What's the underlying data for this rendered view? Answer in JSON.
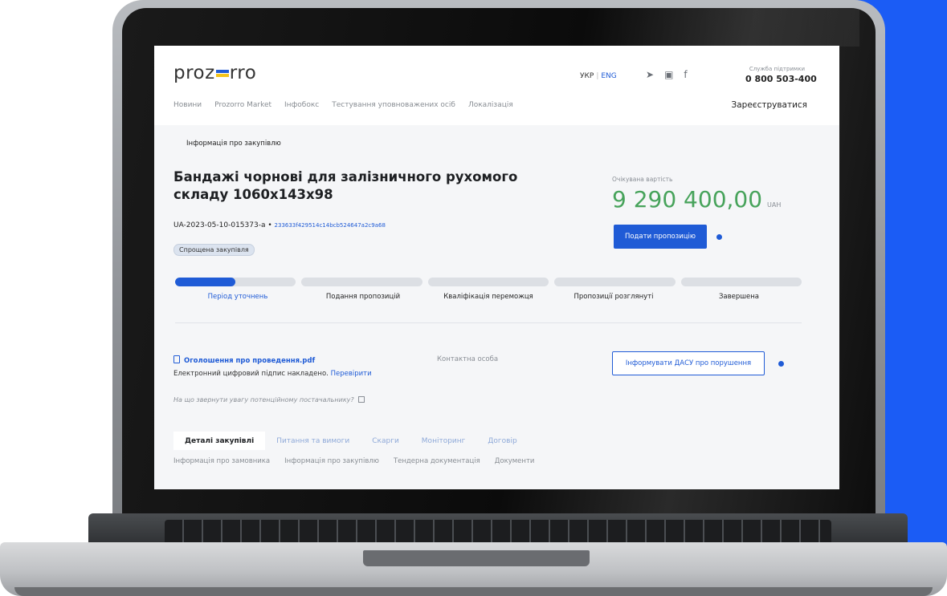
{
  "header": {
    "logo_left": "proz",
    "logo_right": "rro",
    "lang_active": "УКР",
    "lang_alt": "ENG",
    "support_label": "Служба підтримки",
    "support_phone": "0 800 503-400",
    "social_icons": [
      "telegram-icon",
      "youtube-icon",
      "facebook-icon"
    ],
    "register": "Зареєструватися",
    "nav": [
      "Новини",
      "Prozorro Market",
      "Інфобокс",
      "Тестування уповноважених осіб",
      "Локалізація"
    ]
  },
  "tender": {
    "breadcrumb": "Інформація про закупівлю",
    "title": "Бандажі чорнові для залізничного рухомого складу 1060x143x98",
    "id": "UA-2023-05-10-015373-a",
    "bullet": "•",
    "hash": "233633f429514c14bcb524647a2c9a68",
    "tag": "Спрощена закупівля",
    "expected_label": "Очікувана вартість",
    "expected_value": "9 290 400,00",
    "currency": "UAH",
    "offer_button": "Подати пропозицію",
    "progress_fraction": 0.5
  },
  "steps": [
    "Період уточнень",
    "Подання пропозицій",
    "Кваліфікація переможця",
    "Пропозиції розглянуті",
    "Завершена"
  ],
  "documents": {
    "file": "Оголошення про проведення.pdf",
    "signature_text": "Електронний цифровий підпис накладено.",
    "signature_link": "Перевірити",
    "hint": "На що звернути увагу потенційному постачальнику?",
    "contact": "Контактна особа",
    "dasu_button": "Інформувати ДАСУ про порушення"
  },
  "tabs": [
    "Деталі закупівлі",
    "Питання та вимоги",
    "Скарги",
    "Моніторинг",
    "Договір"
  ],
  "subtabs": [
    "Інформація про замовника",
    "Інформація про закупівлю",
    "Тендерна документація",
    "Документи"
  ],
  "colors": {
    "accent": "#1f5bd6",
    "price": "#47a35b",
    "brand_blue": "#1b5cf5",
    "brand_yellow": "#f4c41a"
  }
}
